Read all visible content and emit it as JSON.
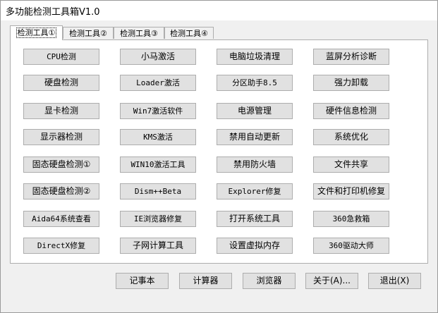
{
  "window": {
    "title": "多功能检测工具箱V1.0"
  },
  "tabs": [
    {
      "label": "检测工具①",
      "active": true
    },
    {
      "label": "检测工具②",
      "active": false
    },
    {
      "label": "检测工具③",
      "active": false
    },
    {
      "label": "检测工具④",
      "active": false
    }
  ],
  "grid": {
    "col1": [
      "CPU检测",
      "硬盘检测",
      "显卡检测",
      "显示器检测",
      "固态硬盘检测①",
      "固态硬盘检测②",
      "Aida64系统查看",
      "DirectX修复"
    ],
    "col2": [
      "小马激活",
      "Loader激活",
      "Win7激活软件",
      "KMS激活",
      "WIN10激活工具",
      "Dism++Beta",
      "IE浏览器修复",
      "子网计算工具"
    ],
    "col3": [
      "电脑垃圾清理",
      "分区助手8.5",
      "电源管理",
      "禁用自动更新",
      "禁用防火墙",
      "Explorer修复",
      "打开系统工具",
      "设置虚拟内存"
    ],
    "col4": [
      "蓝屏分析诊断",
      "强力卸载",
      "硬件信息检测",
      "系统优化",
      "文件共享",
      "文件和打印机修复",
      "360急救箱",
      "360驱动大师"
    ]
  },
  "bottom": {
    "notepad": "记事本",
    "calculator": "计算器",
    "browser": "浏览器",
    "about": "关于(A)...",
    "exit": "退出(X)"
  },
  "colors": {
    "button_face": "#e1e1e1",
    "button_border": "#adadad",
    "window_bg": "#f0f0f0",
    "panel_bg": "#ffffff"
  }
}
